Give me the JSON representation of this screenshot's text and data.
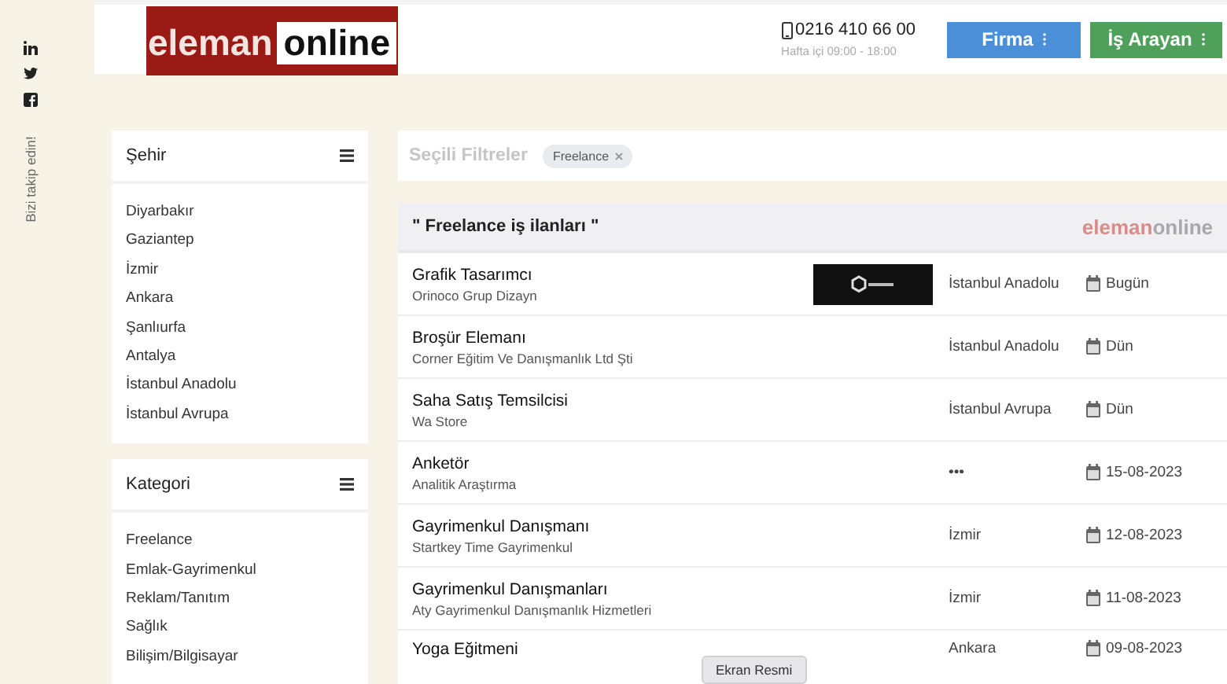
{
  "social": {
    "follow_text": "Bizi takip edin!"
  },
  "header": {
    "logo": {
      "part1": "eleman",
      "part2": "online"
    },
    "phone": "0216 410 66 00",
    "hours": "Hafta içi 09:00 - 18:00",
    "buttons": [
      {
        "label": "Firma",
        "color": "#4a8fd8"
      },
      {
        "label": "İş Arayan",
        "color": "#4ea05a"
      }
    ]
  },
  "sidebar": [
    {
      "title": "Şehir",
      "items": [
        "Diyarbakır",
        "Gaziantep",
        "İzmir",
        "Ankara",
        "Şanlıurfa",
        "Antalya",
        "İstanbul Anadolu",
        "İstanbul Avrupa"
      ]
    },
    {
      "title": "Kategori",
      "items": [
        "Freelance",
        "Emlak-Gayrimenkul",
        "Reklam/Tanıtım",
        "Sağlık",
        "Bilişim/Bilgisayar"
      ]
    }
  ],
  "filters": {
    "title": "Seçili Filtreler",
    "chips": [
      {
        "label": "Freelance"
      }
    ]
  },
  "listings": {
    "title": "\" Freelance iş ilanları \"",
    "brand": {
      "part1": "eleman",
      "part2": "online"
    },
    "rows": [
      {
        "title": "Grafik Tasarımcı",
        "company": "Orinoco Grup Dizayn",
        "logo": true,
        "city": "İstanbul Anadolu",
        "date": "Bugün"
      },
      {
        "title": "Broşür Elemanı",
        "company": "Corner Eğitim Ve Danışmanlık Ltd Şti",
        "logo": false,
        "city": "İstanbul Anadolu",
        "date": "Dün"
      },
      {
        "title": "Saha Satış Temsilcisi",
        "company": "Wa Store",
        "logo": false,
        "city": "İstanbul Avrupa",
        "date": "Dün"
      },
      {
        "title": "Anketör",
        "company": "Analitik Araştırma",
        "logo": false,
        "city": "•••",
        "date": "15-08-2023"
      },
      {
        "title": "Gayrimenkul Danışmanı",
        "company": "Startkey Time Gayrimenkul",
        "logo": false,
        "city": "İzmir",
        "date": "12-08-2023"
      },
      {
        "title": "Gayrimenkul Danışmanları",
        "company": "Aty Gayrimenkul Danışmanlık Hizmetleri",
        "logo": false,
        "city": "İzmir",
        "date": "11-08-2023"
      },
      {
        "title": "Yoga Eğitmeni",
        "logo": false,
        "city": "Ankara",
        "date": "09-08-2023"
      }
    ]
  },
  "tooltip": {
    "label": "Ekran Resmi"
  }
}
